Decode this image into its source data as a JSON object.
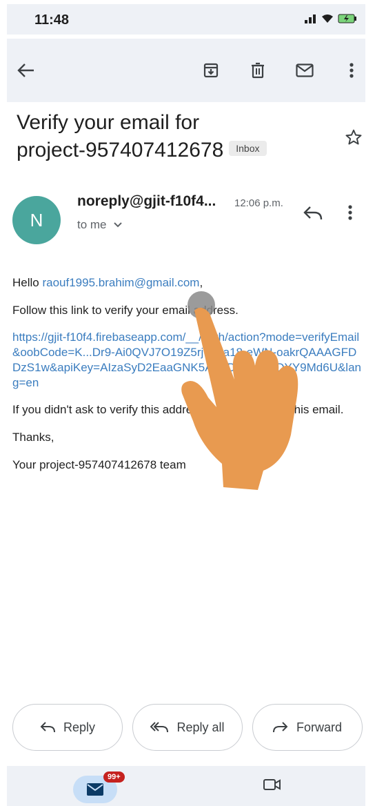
{
  "status_bar": {
    "time": "11:48"
  },
  "email": {
    "subject_line1": "Verify your email for",
    "subject_line2": "project-957407412678",
    "label": "Inbox",
    "avatar_letter": "N",
    "sender": "noreply@gjit-f10f4...",
    "time": "12:06 p.m.",
    "recipient": "to me"
  },
  "body": {
    "greeting_prefix": "Hello ",
    "greeting_email": "raouf1995.brahim@gmail.com",
    "greeting_suffix": ",",
    "instruction": "Follow this link to verify your email address.",
    "verify_link": "https://gjit-f10f4.firebaseapp.com/__/auth/action?mode=verifyEmail&oobCode=K...Dr9-Ai0QVJ7O19Z5rjWRa18-eWN-oakrQAAAGFDDzS1w&apiKey=AIzaSyD2EaaGNK5AAuDgz8S...rDYY9Md6U&lang=en",
    "ignore_note": "If you didn't ask to verify this address, you can ignore this email.",
    "thanks": "Thanks,",
    "signature": "Your project-957407412678 team"
  },
  "actions": {
    "reply": "Reply",
    "reply_all": "Reply all",
    "forward": "Forward"
  },
  "bottom_nav": {
    "mail_badge": "99+"
  },
  "colors": {
    "app_bar_bg": "#eef1f6",
    "avatar_bg": "#4aa69d",
    "link": "#3b7dbf",
    "badge_bg": "#c5221f",
    "hand": "#e89a50"
  }
}
